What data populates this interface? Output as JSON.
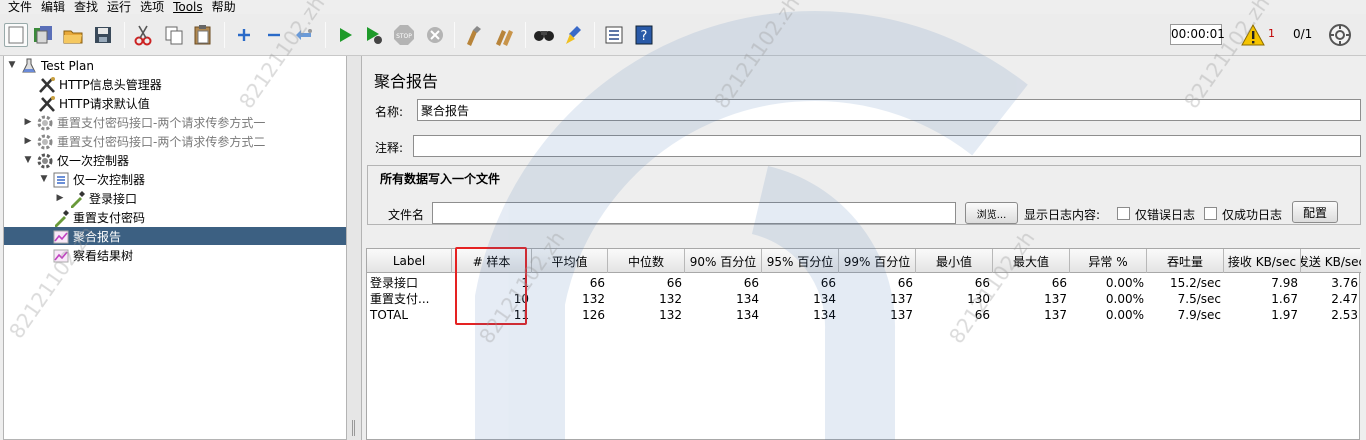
{
  "menu": [
    "文件",
    "编辑",
    "查找",
    "运行",
    "选项",
    "Tools",
    "帮助"
  ],
  "toolbar": {
    "timer": "00:00:01",
    "warn_count": "1",
    "threads": "0/1"
  },
  "tree": {
    "nodes": [
      {
        "label": "Test Plan"
      },
      {
        "label": "HTTP信息头管理器"
      },
      {
        "label": "HTTP请求默认值"
      },
      {
        "label": "重置支付密码接口-两个请求传参方式一"
      },
      {
        "label": "重置支付密码接口-两个请求传参方式二"
      },
      {
        "label": "仅一次控制器"
      },
      {
        "label": "仅一次控制器"
      },
      {
        "label": "登录接口"
      },
      {
        "label": "重置支付密码"
      },
      {
        "label": "聚合报告"
      },
      {
        "label": "察看结果树"
      }
    ]
  },
  "panel": {
    "title": "聚合报告",
    "name_label": "名称:",
    "name_value": "聚合报告",
    "comment_label": "注释:",
    "comment_value": "",
    "file_legend": "所有数据写入一个文件",
    "file_label": "文件名",
    "file_value": "",
    "browse_label": "浏览...",
    "log_label": "显示日志内容:",
    "errors_only_label": "仅错误日志",
    "success_only_label": "仅成功日志",
    "config_label": "配置"
  },
  "table": {
    "headers": [
      "Label",
      "# 样本",
      "平均值",
      "中位数",
      "90% 百分位",
      "95% 百分位",
      "99% 百分位",
      "最小值",
      "最大值",
      "异常 %",
      "吞吐量",
      "接收 KB/sec",
      "发送 KB/sec"
    ],
    "rows": [
      [
        "登录接口",
        "1",
        "66",
        "66",
        "66",
        "66",
        "66",
        "66",
        "66",
        "0.00%",
        "15.2/sec",
        "7.98",
        "3.76"
      ],
      [
        "重置支付...",
        "10",
        "132",
        "132",
        "134",
        "134",
        "137",
        "130",
        "137",
        "0.00%",
        "7.5/sec",
        "1.67",
        "2.47"
      ],
      [
        "TOTAL",
        "11",
        "126",
        "132",
        "134",
        "134",
        "137",
        "66",
        "137",
        "0.00%",
        "7.9/sec",
        "1.97",
        "2.53"
      ]
    ]
  },
  "watermark": "82121102.zh",
  "colors": {
    "selection": "#3c6082",
    "highlight_box": "#e52222",
    "warning": "#f5c400"
  }
}
